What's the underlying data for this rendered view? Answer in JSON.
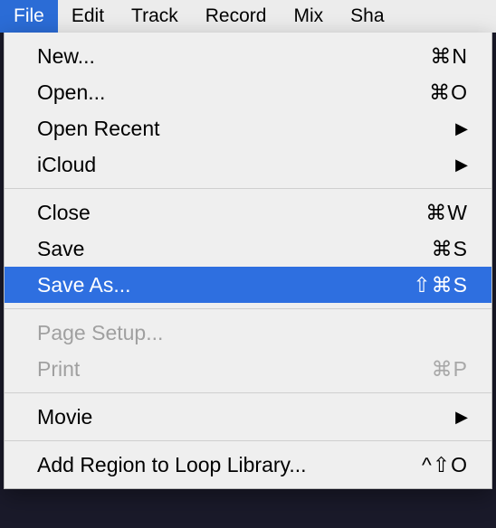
{
  "menubar": {
    "items": [
      {
        "label": "File",
        "active": true
      },
      {
        "label": "Edit",
        "active": false
      },
      {
        "label": "Track",
        "active": false
      },
      {
        "label": "Record",
        "active": false
      },
      {
        "label": "Mix",
        "active": false
      },
      {
        "label": "Sha",
        "active": false
      }
    ]
  },
  "menu": {
    "new": {
      "label": "New...",
      "shortcut": "⌘N"
    },
    "open": {
      "label": "Open...",
      "shortcut": "⌘O"
    },
    "open_recent": {
      "label": "Open Recent"
    },
    "icloud": {
      "label": "iCloud"
    },
    "close": {
      "label": "Close",
      "shortcut": "⌘W"
    },
    "save": {
      "label": "Save",
      "shortcut": "⌘S"
    },
    "save_as": {
      "label": "Save As...",
      "shortcut": "⇧⌘S"
    },
    "page_setup": {
      "label": "Page Setup..."
    },
    "print": {
      "label": "Print",
      "shortcut": "⌘P"
    },
    "movie": {
      "label": "Movie"
    },
    "add_region": {
      "label": "Add Region to Loop Library...",
      "shortcut": "^⇧O"
    }
  }
}
